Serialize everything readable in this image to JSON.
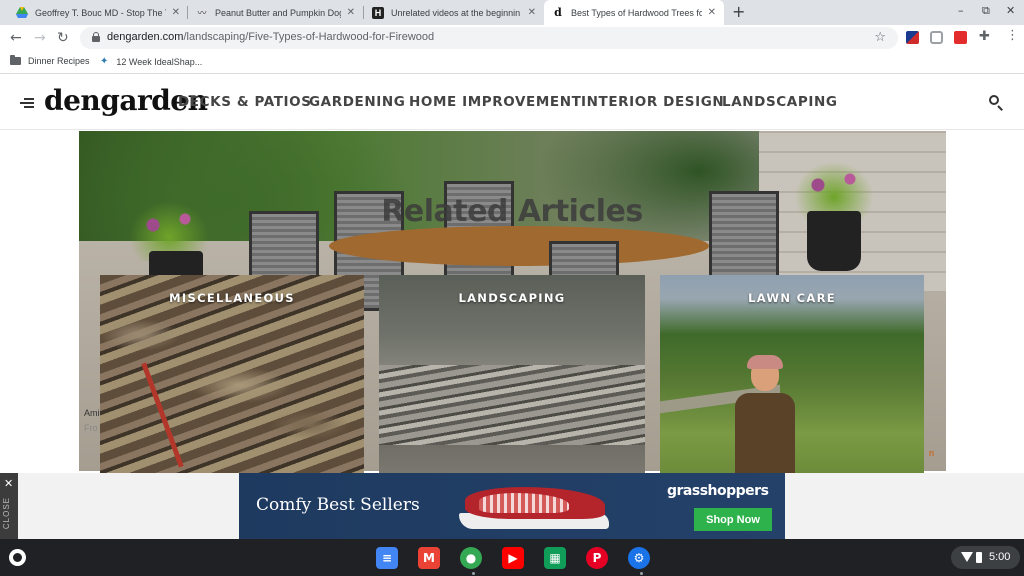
{
  "browser": {
    "tabs": [
      {
        "title": "Geoffrey T. Bouc MD - Stop The T",
        "favicon": "drive-icon",
        "active": false
      },
      {
        "title": "Peanut Butter and Pumpkin Dog",
        "favicon": "signature-icon",
        "active": false
      },
      {
        "title": "Unrelated videos at the beginnin",
        "favicon": "h-icon",
        "active": false
      },
      {
        "title": "Best Types of Hardwood Trees fo",
        "favicon": "dengarden-d-icon",
        "active": true
      }
    ],
    "new_tab": "+",
    "window_controls": {
      "minimize": "–",
      "restore": "⧉",
      "close": "✕"
    },
    "url_host": "dengarden.com",
    "url_path": "/landscaping/Five-Types-of-Hardwood-for-Firewood",
    "bookmarks": [
      {
        "label": "Dinner Recipes",
        "icon": "folder-icon"
      },
      {
        "label": "12 Week IdealShap...",
        "icon": "runner-icon"
      }
    ]
  },
  "site": {
    "logo": "dengarden",
    "nav": [
      "DECKS & PATIOS",
      "GARDENING",
      "HOME IMPROVEMENT",
      "INTERIOR DESIGN",
      "LANDSCAPING"
    ]
  },
  "related": {
    "heading": "Related Articles",
    "cards": [
      {
        "label": "MISCELLANEOUS"
      },
      {
        "label": "LANDSCAPING"
      },
      {
        "label": "LAWN CARE"
      }
    ],
    "peek_text": [
      "Ami",
      "Fro"
    ],
    "peek_link": "n"
  },
  "ad": {
    "close_x": "✕",
    "close_label": "CLOSE",
    "headline": "Comfy Best Sellers",
    "brand": "grasshoppers",
    "cta": "Shop Now",
    "choices": [
      "▷",
      "✕"
    ]
  },
  "shelf": {
    "apps": [
      {
        "name": "docs-icon",
        "glyph": "≡",
        "color": "#4285f4"
      },
      {
        "name": "gmail-icon",
        "glyph": "M",
        "color": "#ea4335"
      },
      {
        "name": "chrome-icon",
        "glyph": "●",
        "color": "#34a853"
      },
      {
        "name": "youtube-icon",
        "glyph": "▶",
        "color": "#ff0000"
      },
      {
        "name": "sheets-icon",
        "glyph": "▦",
        "color": "#0f9d58"
      },
      {
        "name": "pinterest-icon",
        "glyph": "P",
        "color": "#e60023"
      },
      {
        "name": "settings-icon",
        "glyph": "⚙",
        "color": "#1a73e8"
      }
    ],
    "time": "5:00"
  }
}
